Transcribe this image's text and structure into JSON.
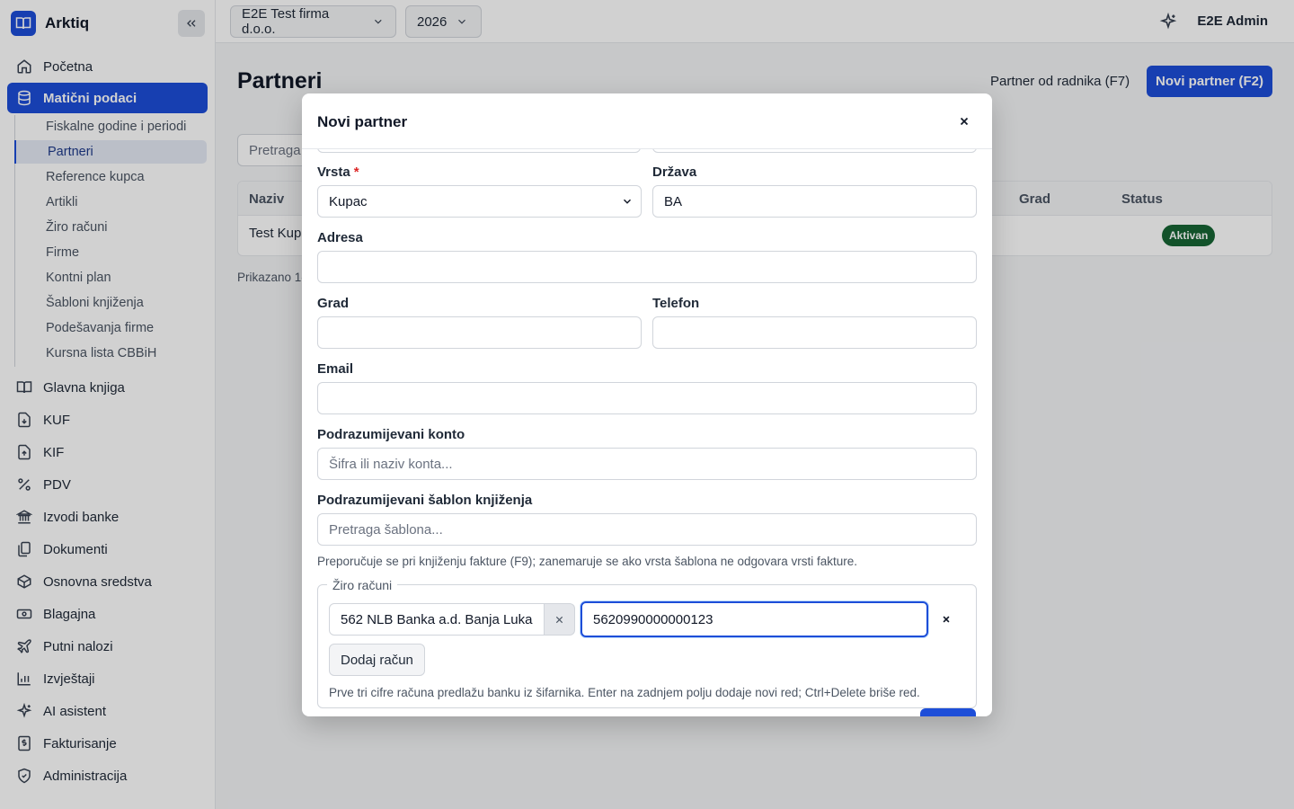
{
  "app": {
    "name": "Arktiq",
    "company_selector": "E2E Test firma d.o.o.",
    "year_selector": "2026",
    "user": "E2E Admin"
  },
  "sidebar": {
    "items": [
      {
        "label": "Početna",
        "icon": "home-icon"
      },
      {
        "label": "Matični podaci",
        "icon": "database-icon",
        "active": true
      },
      {
        "label": "Glavna knjiga",
        "icon": "book-icon"
      },
      {
        "label": "KUF",
        "icon": "file-download-icon"
      },
      {
        "label": "KIF",
        "icon": "file-upload-icon"
      },
      {
        "label": "PDV",
        "icon": "percent-icon"
      },
      {
        "label": "Izvodi banke",
        "icon": "bank-icon"
      },
      {
        "label": "Dokumenti",
        "icon": "documents-icon"
      },
      {
        "label": "Osnovna sredstva",
        "icon": "box-icon"
      },
      {
        "label": "Blagajna",
        "icon": "cash-icon"
      },
      {
        "label": "Putni nalozi",
        "icon": "plane-icon"
      },
      {
        "label": "Izvještaji",
        "icon": "chart-icon"
      },
      {
        "label": "AI asistent",
        "icon": "sparkle-icon"
      },
      {
        "label": "Fakturisanje",
        "icon": "invoice-icon"
      },
      {
        "label": "Administracija",
        "icon": "shield-icon"
      }
    ],
    "subitems": [
      {
        "label": "Fiskalne godine i periodi"
      },
      {
        "label": "Partneri",
        "active": true
      },
      {
        "label": "Reference kupca"
      },
      {
        "label": "Artikli"
      },
      {
        "label": "Žiro računi"
      },
      {
        "label": "Firme"
      },
      {
        "label": "Kontni plan"
      },
      {
        "label": "Šabloni knjiženja"
      },
      {
        "label": "Podešavanja firme"
      },
      {
        "label": "Kursna lista CBBiH"
      }
    ]
  },
  "page": {
    "title": "Partneri",
    "btn_from_employee": "Partner od radnika (F7)",
    "btn_new_partner": "Novi partner (F2)",
    "search_placeholder": "Pretraga",
    "table": {
      "col_name": "Naziv",
      "col_city": "Grad",
      "col_status": "Status",
      "row_name": "Test Kup",
      "row_status": "Aktivan"
    },
    "showing": "Prikazano 1-"
  },
  "modal": {
    "title": "Novi partner",
    "type_label": "Vrsta",
    "type_value": "Kupac",
    "country_label": "Država",
    "country_value": "BA",
    "address_label": "Adresa",
    "city_label": "Grad",
    "phone_label": "Telefon",
    "email_label": "Email",
    "account_label": "Podrazumijevani konto",
    "account_placeholder": "Šifra ili naziv konta...",
    "template_label": "Podrazumijevani šablon knjiženja",
    "template_placeholder": "Pretraga šablona...",
    "template_hint": "Preporučuje se pri knjiženju fakture (F9); zanemaruje se ako vrsta šablona ne odgovara vrsti fakture.",
    "bank_section_title": "Žiro računi",
    "bank_value": "562 NLB Banka a.d. Banja Luka",
    "account_number": "5620990000000123",
    "add_account_button": "Dodaj račun",
    "bank_hint": "Prve tri cifre računa predlažu banku iz šifarnika. Enter na zadnjem polju dodaje novi red; Ctrl+Delete briše red."
  }
}
